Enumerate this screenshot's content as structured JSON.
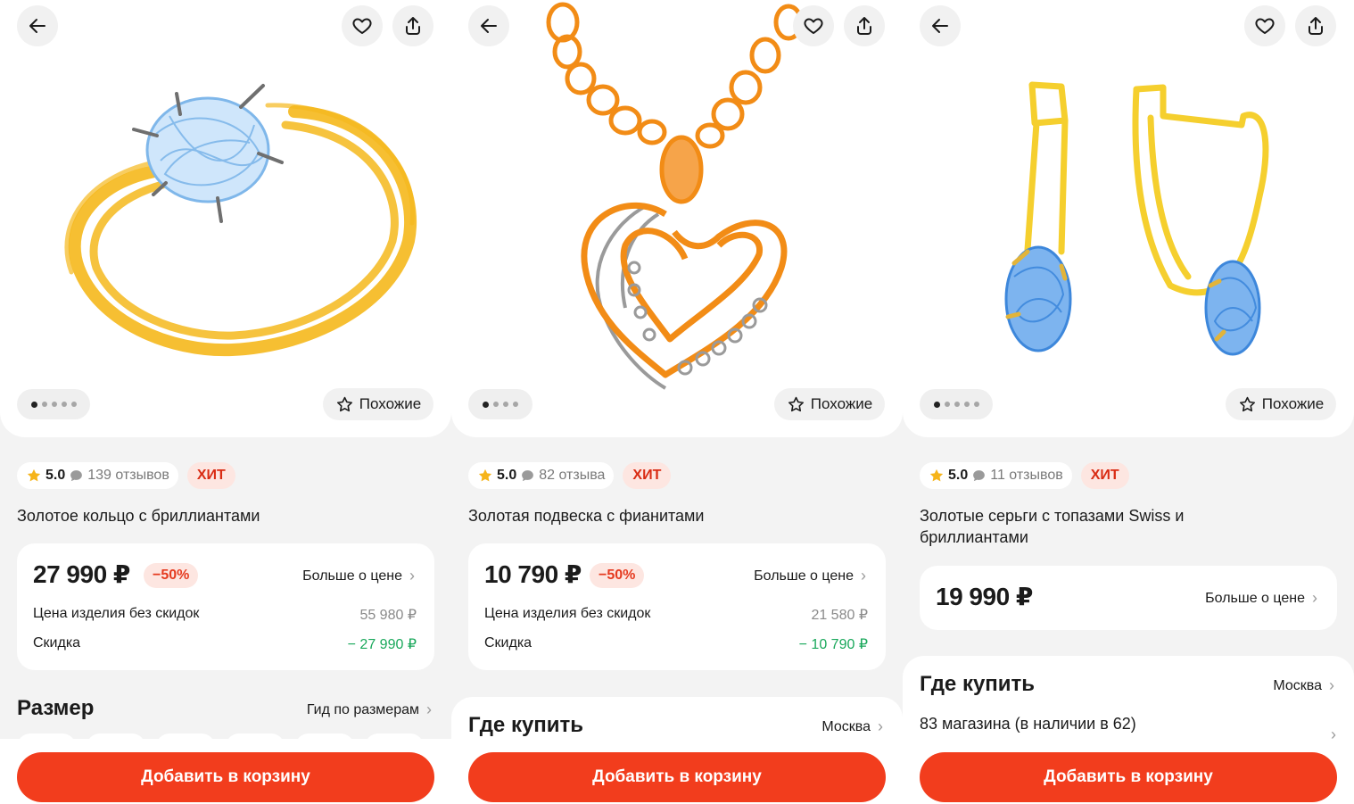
{
  "common": {
    "similar_label": "Похожие",
    "more_price_label": "Больше о цене",
    "add_to_cart_label": "Добавить в корзину",
    "hit_label": "ХИТ",
    "price_without_discount_label": "Цена изделия без скидок",
    "discount_label": "Скидка",
    "where_to_buy_label": "Где купить",
    "city": "Москва",
    "accent_color": "#f23d1d",
    "icons": [
      "arrow-left-icon",
      "heart-icon",
      "share-icon",
      "star-outline-icon",
      "star-icon",
      "comment-icon",
      "chevron-right-icon"
    ]
  },
  "screens": [
    {
      "rating": "5.0",
      "reviews": "139 отзывов",
      "title": "Золотое кольцо с бриллиантами",
      "price": "27 990 ₽",
      "discount_badge": "−50%",
      "price_without_discount": "55 980 ₽",
      "discount_value": "− 27 990 ₽",
      "gallery": {
        "total": 5,
        "active": 1
      },
      "size_section": {
        "title": "Размер",
        "link": "Гид по размерам"
      }
    },
    {
      "rating": "5.0",
      "reviews": "82 отзыва",
      "title": "Золотая подвеска с фианитами",
      "price": "10 790 ₽",
      "discount_badge": "−50%",
      "price_without_discount": "21 580 ₽",
      "discount_value": "− 10 790 ₽",
      "gallery": {
        "total": 4,
        "active": 1
      }
    },
    {
      "rating": "5.0",
      "reviews": "11 отзывов",
      "title": "Золотые серьги с топазами Swiss и бриллиантами",
      "price": "19 990 ₽",
      "gallery": {
        "total": 5,
        "active": 1
      },
      "stores": "83 магазина (в наличии в 62)"
    }
  ]
}
